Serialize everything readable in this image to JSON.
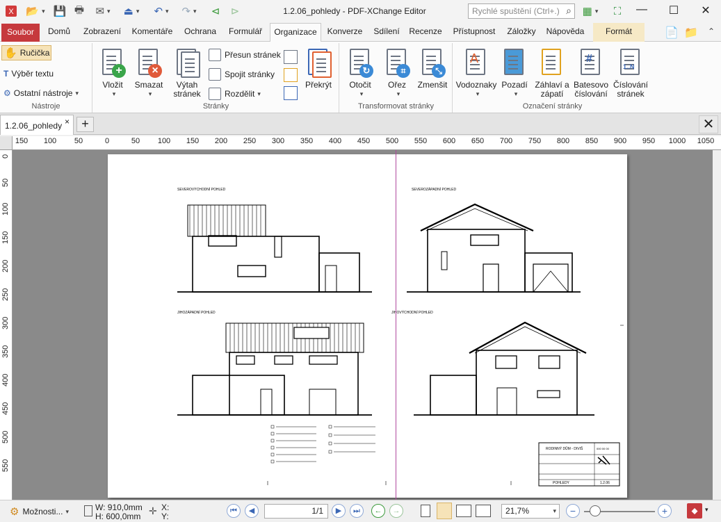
{
  "window": {
    "title": "1.2.06_pohledy - PDF-XChange Editor",
    "quick_launch_placeholder": "Rychlé spuštění (Ctrl+.)"
  },
  "menu": {
    "tabs": [
      "Soubor",
      "Domů",
      "Zobrazení",
      "Komentáře",
      "Ochrana",
      "Formulář",
      "Organizace",
      "Konverze",
      "Sdílení",
      "Recenze",
      "Přístupnost",
      "Záložky",
      "Nápověda",
      "Formát"
    ],
    "active": "Organizace"
  },
  "ribbon": {
    "tools_group": {
      "hand": "Ručička",
      "select_text": "Výběr textu",
      "other_tools": "Ostatní nástroje",
      "label": "Nástroje"
    },
    "pages_group": {
      "insert": "Vložit",
      "delete": "Smazat",
      "extract_1": "Výtah",
      "extract_2": "stránek",
      "move": "Přesun stránek",
      "merge": "Spojit stránky",
      "split": "Rozdělit",
      "overlay": "Překrýt",
      "label": "Stránky"
    },
    "transform_group": {
      "rotate": "Otočit",
      "crop": "Ořez",
      "shrink": "Zmenšit",
      "label": "Transformovat stránky"
    },
    "mark_group": {
      "watermark": "Vodoznaky",
      "background": "Pozadí",
      "header_1": "Záhlaví a",
      "header_2": "zápatí",
      "bates_1": "Batesovo",
      "bates_2": "číslování",
      "number_1": "Číslování",
      "number_2": "stránek",
      "label": "Označení stránky"
    }
  },
  "document_tab": {
    "name": "1.2.06_pohledy"
  },
  "rulers": {
    "horizontal": [
      "150",
      "100",
      "50",
      "0",
      "50",
      "100",
      "150",
      "200",
      "250",
      "300",
      "350",
      "400",
      "450",
      "500",
      "550",
      "600",
      "650",
      "700",
      "750",
      "800",
      "850",
      "900",
      "950",
      "1000",
      "1050"
    ],
    "vertical": [
      "0",
      "50",
      "100",
      "150",
      "200",
      "250",
      "300",
      "350",
      "400",
      "450",
      "500",
      "550"
    ]
  },
  "drawing": {
    "view_titles": [
      "SEVEROVÝCHODNÍ POHLED",
      "SEVEROZÁPADNÍ POHLED",
      "JIHOZÁPADNÍ POHLED",
      "JIHOVÝCHODNÍ POHLED"
    ],
    "title_block": {
      "project": "RODINNÝ DŮM - DIVIŠ",
      "drawing": "POHLEDY",
      "number": "1.2.06",
      "code": "000 00 00"
    }
  },
  "status": {
    "options": "Možnosti...",
    "width": "W: 910,0mm",
    "height": "H: 600,0mm",
    "x": "X:",
    "y": "Y:",
    "page": "1/1",
    "zoom": "21,7%"
  }
}
